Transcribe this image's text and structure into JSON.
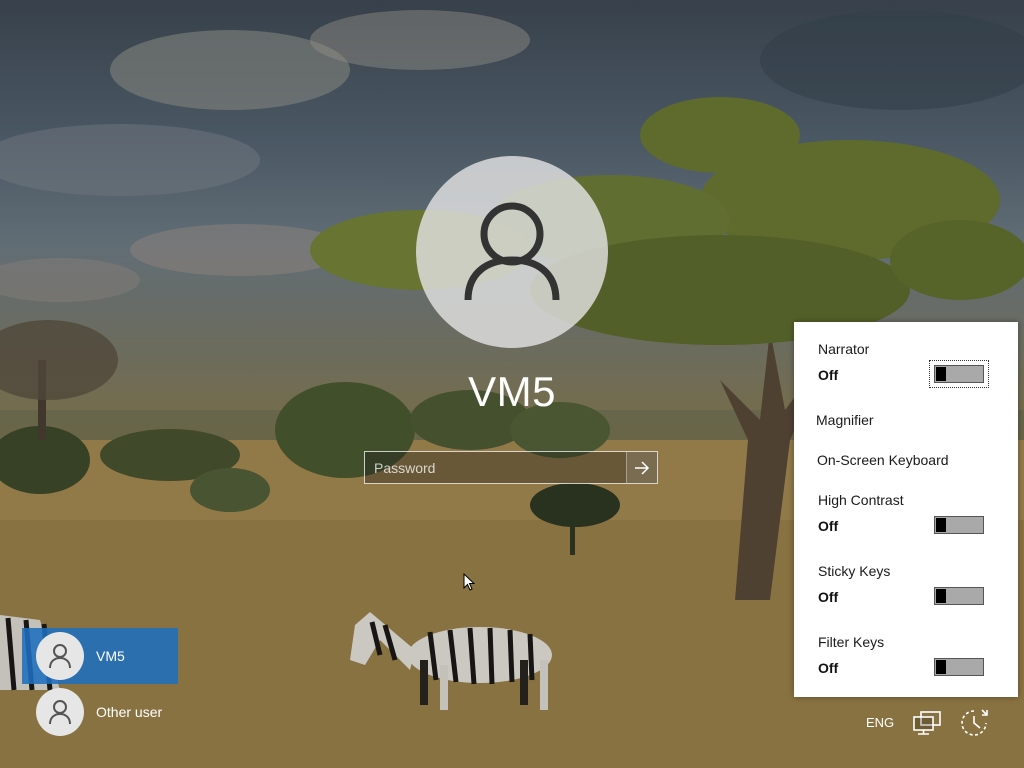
{
  "user": {
    "name": "VM5"
  },
  "password": {
    "placeholder": "Password"
  },
  "user_list": [
    {
      "name": "VM5",
      "selected": true
    },
    {
      "name": "Other user",
      "selected": false
    }
  ],
  "ease_of_access": {
    "narrator": {
      "label": "Narrator",
      "state": "Off"
    },
    "magnifier": {
      "label": "Magnifier"
    },
    "on_screen_keyboard": {
      "label": "On-Screen Keyboard"
    },
    "high_contrast": {
      "label": "High Contrast",
      "state": "Off"
    },
    "sticky_keys": {
      "label": "Sticky Keys",
      "state": "Off"
    },
    "filter_keys": {
      "label": "Filter Keys",
      "state": "Off"
    }
  },
  "tray": {
    "language": "ENG",
    "network_icon": "network-icon",
    "ease_of_access_icon": "ease-of-access-icon"
  },
  "colors": {
    "selected_user": "#1e6ebe",
    "flyout_bg": "#ffffff"
  }
}
